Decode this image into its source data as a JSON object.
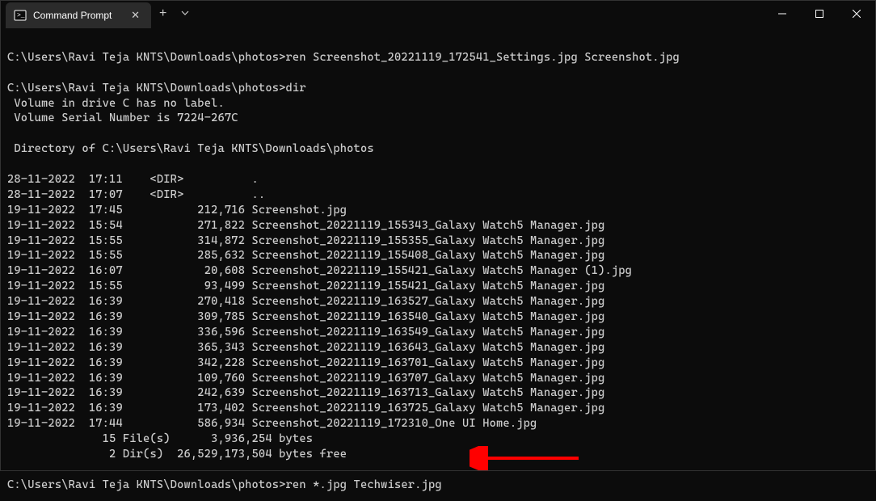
{
  "window": {
    "tab_title": "Command Prompt"
  },
  "terminal": {
    "lines": [
      "",
      "C:\\Users\\Ravi Teja KNTS\\Downloads\\photos>ren Screenshot_20221119_172541_Settings.jpg Screenshot.jpg",
      "",
      "C:\\Users\\Ravi Teja KNTS\\Downloads\\photos>dir",
      " Volume in drive C has no label.",
      " Volume Serial Number is 7224-267C",
      "",
      " Directory of C:\\Users\\Ravi Teja KNTS\\Downloads\\photos",
      "",
      "28-11-2022  17:11    <DIR>          .",
      "28-11-2022  17:07    <DIR>          ..",
      "19-11-2022  17:45           212,716 Screenshot.jpg",
      "19-11-2022  15:54           271,822 Screenshot_20221119_155343_Galaxy Watch5 Manager.jpg",
      "19-11-2022  15:55           314,872 Screenshot_20221119_155355_Galaxy Watch5 Manager.jpg",
      "19-11-2022  15:55           285,632 Screenshot_20221119_155408_Galaxy Watch5 Manager.jpg",
      "19-11-2022  16:07            20,608 Screenshot_20221119_155421_Galaxy Watch5 Manager (1).jpg",
      "19-11-2022  15:55            93,499 Screenshot_20221119_155421_Galaxy Watch5 Manager.jpg",
      "19-11-2022  16:39           270,418 Screenshot_20221119_163527_Galaxy Watch5 Manager.jpg",
      "19-11-2022  16:39           309,785 Screenshot_20221119_163540_Galaxy Watch5 Manager.jpg",
      "19-11-2022  16:39           336,596 Screenshot_20221119_163549_Galaxy Watch5 Manager.jpg",
      "19-11-2022  16:39           365,343 Screenshot_20221119_163643_Galaxy Watch5 Manager.jpg",
      "19-11-2022  16:39           342,228 Screenshot_20221119_163701_Galaxy Watch5 Manager.jpg",
      "19-11-2022  16:39           109,760 Screenshot_20221119_163707_Galaxy Watch5 Manager.jpg",
      "19-11-2022  16:39           242,639 Screenshot_20221119_163713_Galaxy Watch5 Manager.jpg",
      "19-11-2022  16:39           173,402 Screenshot_20221119_163725_Galaxy Watch5 Manager.jpg",
      "19-11-2022  17:44           586,934 Screenshot_20221119_172310_One UI Home.jpg",
      "              15 File(s)      3,936,254 bytes",
      "               2 Dir(s)  26,529,173,504 bytes free",
      "",
      "C:\\Users\\Ravi Teja KNTS\\Downloads\\photos>ren *.jpg Techwiser.jpg"
    ]
  }
}
